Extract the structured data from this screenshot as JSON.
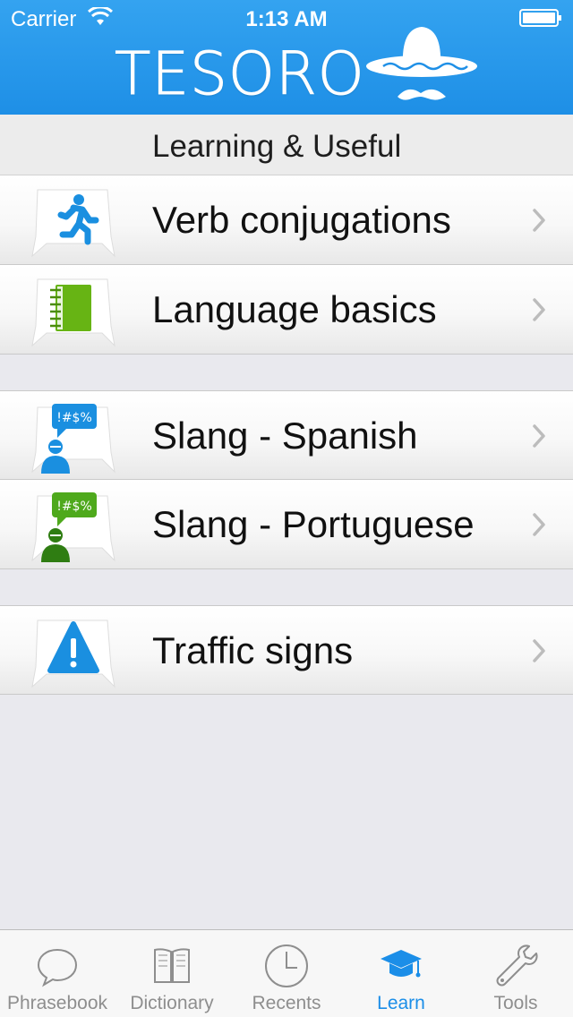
{
  "status_bar": {
    "carrier": "Carrier",
    "time": "1:13 AM"
  },
  "header": {
    "title": "TESORO",
    "logo_icon": "sombrero-icon"
  },
  "section": {
    "title": "Learning & Useful"
  },
  "rows": [
    {
      "label": "Verb conjugations",
      "icon": "running-man-icon"
    },
    {
      "label": "Language basics",
      "icon": "notebook-icon"
    },
    {
      "label": "Slang - Spanish",
      "icon": "slang-speaker-blue-icon",
      "bubble_text": "!#$%"
    },
    {
      "label": "Slang - Portuguese",
      "icon": "slang-speaker-green-icon",
      "bubble_text": "!#$%"
    },
    {
      "label": "Traffic signs",
      "icon": "warning-sign-icon"
    }
  ],
  "tabbar": {
    "active": "Learn",
    "tabs": [
      {
        "label": "Phrasebook",
        "icon": "speech-bubble-icon"
      },
      {
        "label": "Dictionary",
        "icon": "book-icon"
      },
      {
        "label": "Recents",
        "icon": "clock-icon"
      },
      {
        "label": "Learn",
        "icon": "graduation-cap-icon"
      },
      {
        "label": "Tools",
        "icon": "wrench-icon"
      }
    ]
  },
  "colors": {
    "header_blue": "#2196ea",
    "active_tab": "#1b8ee8",
    "inactive_tab": "#8e8e8e",
    "verb_icon": "#1a8fe0",
    "basics_icon": "#67b414",
    "slang_es": "#1a8fe0",
    "slang_pt": "#4ea91c",
    "traffic_icon": "#1a8fe0"
  }
}
